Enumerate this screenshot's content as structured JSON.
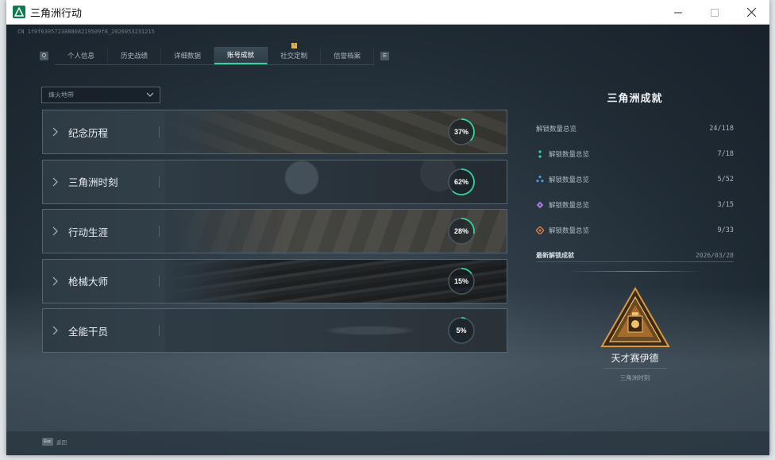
{
  "window": {
    "title": "三角洲行动"
  },
  "build_id": "CN 1f0f639572388868219509f8_2026053231215",
  "tabs": [
    {
      "label": "个人信息",
      "active": false,
      "badge": ""
    },
    {
      "label": "历史战绩",
      "active": false,
      "badge": ""
    },
    {
      "label": "详细数据",
      "active": false,
      "badge": ""
    },
    {
      "label": "账号成就",
      "active": true,
      "badge": ""
    },
    {
      "label": "社交定制",
      "active": false,
      "badge": "!"
    },
    {
      "label": "信誉档案",
      "active": false,
      "badge": ""
    }
  ],
  "tab_keys": {
    "prev": "Q",
    "next": "E"
  },
  "filter": {
    "placeholder": "烽火地带"
  },
  "categories": [
    {
      "name": "纪念历程",
      "progress": 37,
      "progress_text": "37%"
    },
    {
      "name": "三角洲时刻",
      "progress": 62,
      "progress_text": "62%"
    },
    {
      "name": "行动生涯",
      "progress": 28,
      "progress_text": "28%"
    },
    {
      "name": "枪械大师",
      "progress": 15,
      "progress_text": "15%"
    },
    {
      "name": "全能干员",
      "progress": 5,
      "progress_text": "5%"
    }
  ],
  "panel": {
    "title": "三角洲成就",
    "total": {
      "label": "解锁数量总览",
      "value": "24/118"
    },
    "tiers": [
      {
        "label": "解锁数量总览",
        "value": "7/18",
        "color": "#2fd59b",
        "icon": "tier-green-icon"
      },
      {
        "label": "解锁数量总览",
        "value": "5/52",
        "color": "#4aa3e8",
        "icon": "tier-blue-icon"
      },
      {
        "label": "解锁数量总览",
        "value": "3/15",
        "color": "#b07be8",
        "icon": "tier-purple-icon"
      },
      {
        "label": "解锁数量总览",
        "value": "9/33",
        "color": "#e8803c",
        "icon": "tier-orange-icon"
      }
    ],
    "latest": {
      "label": "最新解锁成就",
      "date": "2026/03/28"
    },
    "badge": {
      "name": "天才赛伊德",
      "source": "三角洲时刻"
    }
  },
  "bottom": {
    "esc_key": "Esc",
    "esc_label": "返回"
  },
  "colors": {
    "accent": "#2fd59b",
    "progress_track": "#4a5660"
  }
}
